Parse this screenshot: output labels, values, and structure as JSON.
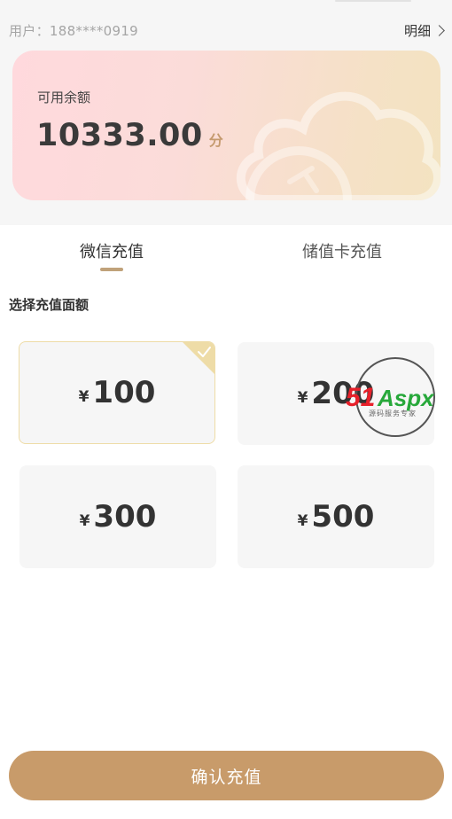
{
  "header": {
    "user_label": "用户：188****0919",
    "detail_label": "明细"
  },
  "balance": {
    "label": "可用余额",
    "value": "10333.00",
    "unit": "分"
  },
  "tabs": [
    {
      "label": "微信充值",
      "active": true
    },
    {
      "label": "储值卡充值",
      "active": false
    }
  ],
  "section_title": "选择充值面额",
  "amounts": [
    {
      "currency": "¥",
      "value": "100",
      "selected": true
    },
    {
      "currency": "¥",
      "value": "200",
      "selected": false
    },
    {
      "currency": "¥",
      "value": "300",
      "selected": false
    },
    {
      "currency": "¥",
      "value": "500",
      "selected": false
    }
  ],
  "watermark": {
    "brand_a": "51",
    "brand_b": "Aspx",
    "tagline": "源码服务专家"
  },
  "confirm_label": "确认充值",
  "colors": {
    "accent": "#c89b6a",
    "tab_underline": "#c0a27a",
    "selected_border": "#eedca7",
    "watermark_red": "#e8202a",
    "watermark_green": "#27a83a"
  },
  "icons": [
    "chevron-right-icon",
    "cloud-decoration",
    "checkmark-icon"
  ]
}
